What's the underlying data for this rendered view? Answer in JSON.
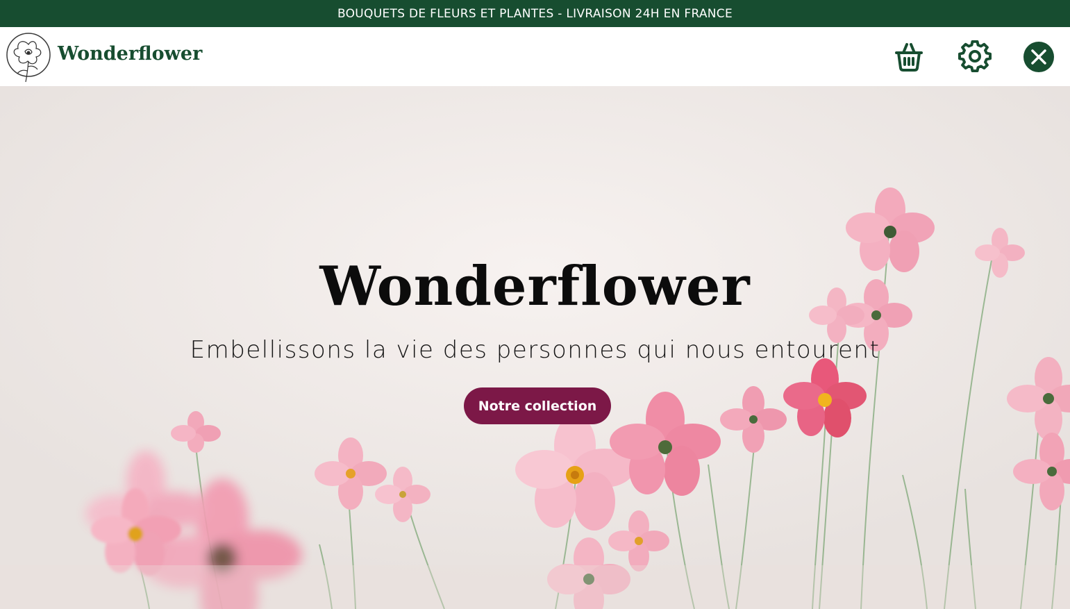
{
  "announcement": {
    "text": "BOUQUETS DE FLEURS ET PLANTES - LIVRAISON 24H EN FRANCE"
  },
  "header": {
    "brand": "Wonderflower",
    "icons": [
      "flower-logo-icon",
      "basket-icon",
      "gear-icon",
      "close-icon"
    ]
  },
  "hero": {
    "title": "Wonderflower",
    "subtitle": "Embellissons la vie des personnes qui nous entourent",
    "cta_label": "Notre collection"
  },
  "colors": {
    "announcement_bg": "#174d30",
    "brand_green": "#174d30",
    "cta_bg": "#7c1847",
    "flower_pink": "#ef9fb6",
    "flower_deep_pink": "#e1546f"
  }
}
